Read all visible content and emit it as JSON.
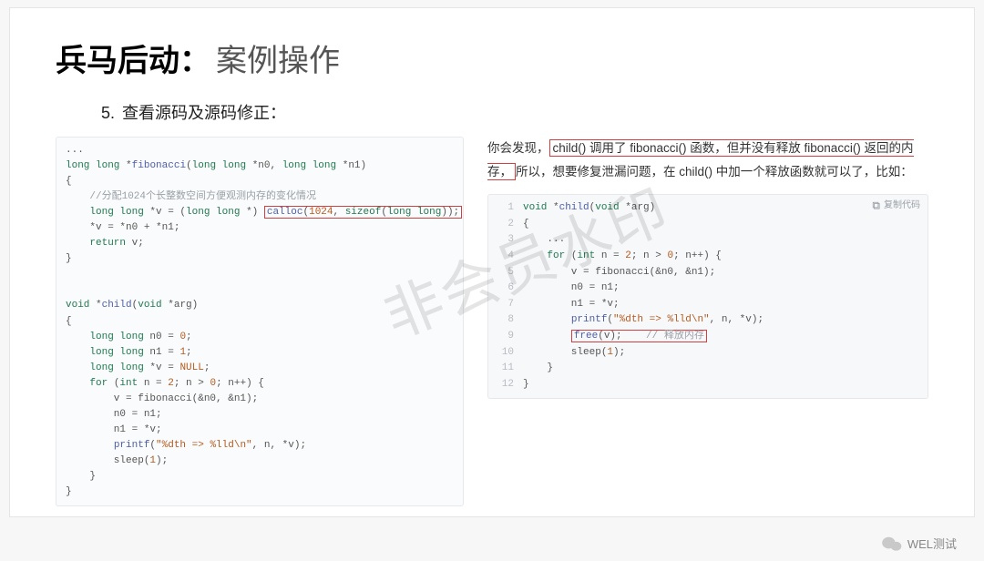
{
  "title_bold": "兵马后动：",
  "title_light": "案例操作",
  "step_num": "5.",
  "step_text": "查看源码及源码修正：",
  "left_code": {
    "l1": "...",
    "l2a": "long long",
    "l2b": "*",
    "l2c": "fibonacci",
    "l2d": "(",
    "l2e": "long long",
    "l2f": " *n0, ",
    "l2g": "long long",
    "l2h": " *n1)",
    "l3": "{",
    "l4": "    //分配1024个长整数空间方便观测内存的变化情况",
    "l5a": "    ",
    "l5b": "long long",
    "l5c": " *v = (",
    "l5d": "long long",
    "l5e": " *) ",
    "l5f": "calloc",
    "l5g": "(",
    "l5h": "1024",
    "l5i": ", ",
    "l5j": "sizeof",
    "l5k": "(",
    "l5l": "long long",
    "l5m": "));",
    "l6": "    *v = *n0 + *n1;",
    "l7a": "    ",
    "l7b": "return",
    "l7c": " v;",
    "l8": "}",
    "l9": "",
    "l10a": "void",
    "l10b": " *",
    "l10c": "child",
    "l10d": "(",
    "l10e": "void",
    "l10f": " *arg)",
    "l11": "{",
    "l12a": "    ",
    "l12b": "long long",
    "l12c": " n0 = ",
    "l12d": "0",
    "l12e": ";",
    "l13a": "    ",
    "l13b": "long long",
    "l13c": " n1 = ",
    "l13d": "1",
    "l13e": ";",
    "l14a": "    ",
    "l14b": "long long",
    "l14c": " *v = ",
    "l14d": "NULL",
    "l14e": ";",
    "l15a": "    ",
    "l15b": "for",
    "l15c": " (",
    "l15d": "int",
    "l15e": " n = ",
    "l15f": "2",
    "l15g": "; n > ",
    "l15h": "0",
    "l15i": "; n++) {",
    "l16": "        v = fibonacci(&n0, &n1);",
    "l17": "        n0 = n1;",
    "l18": "        n1 = *v;",
    "l19a": "        ",
    "l19b": "printf",
    "l19c": "(",
    "l19d": "\"%dth => %lld\\n\"",
    "l19e": ", n, *v);",
    "l20a": "        sleep(",
    "l20b": "1",
    "l20c": ");",
    "l21": "    }",
    "l22": "}"
  },
  "explain": {
    "p1a": "你会发现，",
    "p1b": "child() 调用了 fibonacci() 函数，但并没有释放 fibonacci() 返回的内存，",
    "p1c": "所以，想要修复泄漏问题，在 child() 中加一个释放函数就可以了，比如："
  },
  "copy_label": "复制代码",
  "right_code": {
    "r1a": "void",
    "r1b": " *",
    "r1c": "child",
    "r1d": "(",
    "r1e": "void",
    "r1f": " *arg)",
    "r2": "{",
    "r3": "    ...",
    "r4a": "    ",
    "r4b": "for",
    "r4c": " (",
    "r4d": "int",
    "r4e": " n = ",
    "r4f": "2",
    "r4g": "; n > ",
    "r4h": "0",
    "r4i": "; n++) {",
    "r5": "        v = fibonacci(&n0, &n1);",
    "r6": "        n0 = n1;",
    "r7": "        n1 = *v;",
    "r8a": "        ",
    "r8b": "printf",
    "r8c": "(",
    "r8d": "\"%dth => %lld\\n\"",
    "r8e": ", n, *v);",
    "r9a": "        ",
    "r9b": "free",
    "r9c": "(v);    ",
    "r9d": "// 释放内存",
    "r10a": "        sleep(",
    "r10b": "1",
    "r10c": ");",
    "r11": "    }",
    "r12": "}"
  },
  "watermark_text": "非会员水印",
  "channel_name": "WEL测试"
}
